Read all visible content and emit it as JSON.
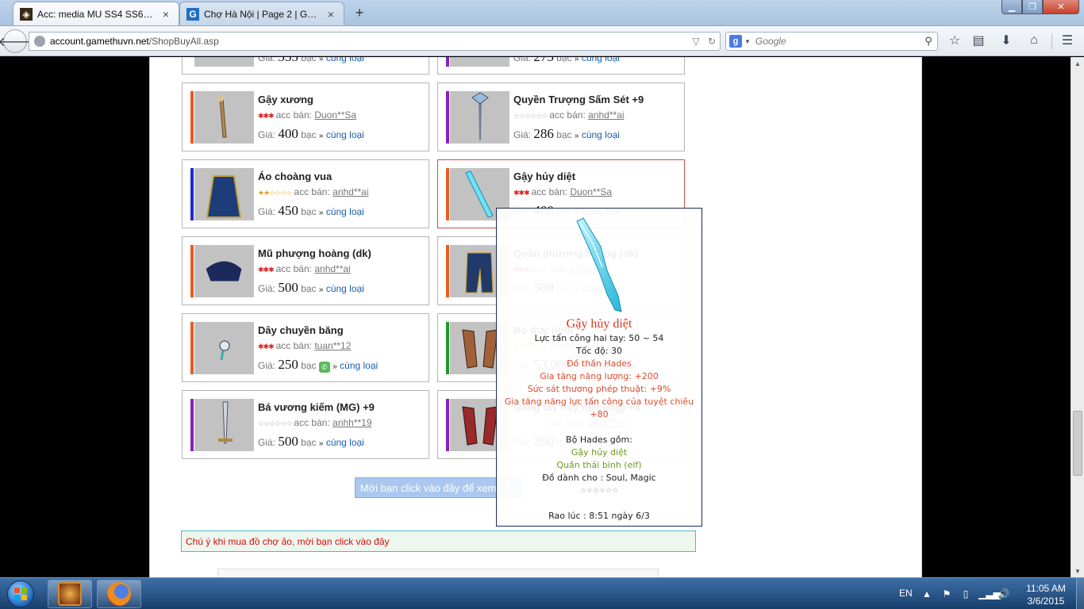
{
  "browser": {
    "tabs": [
      {
        "title": "Acc: media MU SS4 SS6 SS...",
        "active": true
      },
      {
        "title": "Chợ Hà Nội | Page 2 | Gam...",
        "active": false
      }
    ],
    "url_host": "account.gamethuvn.net",
    "url_path": "/ShopBuyAll.asp",
    "search_placeholder": "Google",
    "new_tab": "+",
    "close": "×"
  },
  "partial_row": {
    "left_price_prefix": "Giá:",
    "left_price": "555",
    "right_price_prefix": "Giá:",
    "right_price": "275",
    "unit": "bạc",
    "more": "cùng loại"
  },
  "items": [
    {
      "name": "Gậy xương",
      "stars": "✱✱✱",
      "star_color": "#e02020",
      "seller_label": "acc bán:",
      "seller": "Duon**Sa",
      "price_label": "Giá:",
      "price": "400",
      "unit": "bạc",
      "more": "cùng loại",
      "bar_color": "#e85a1e"
    },
    {
      "name": "Quyền Trượng Sấm Sét +9",
      "stars": "☆☆☆☆☆☆",
      "star_color": "#aaaaaa",
      "seller_label": "acc bán:",
      "seller": "anhd**ai",
      "price_label": "Giá:",
      "price": "286",
      "unit": "bạc",
      "more": "cùng loại",
      "bar_color": "#8a1fc0"
    },
    {
      "name": "Áo choàng vua",
      "stars": "★★☆☆☆☆",
      "star_color": "#e0a020",
      "seller_label": "acc bán:",
      "seller": "anhd**ai",
      "price_label": "Giá:",
      "price": "450",
      "unit": "bạc",
      "more": "cùng loại",
      "bar_color": "#1a2ad8"
    },
    {
      "name": "Gậy hủy diệt",
      "stars": "✱✱✱",
      "star_color": "#e02020",
      "seller_label": "acc bán:",
      "seller": "Duon**Sa",
      "price_label": "Giá:",
      "price": "400",
      "unit": "bạc",
      "more": "cùng loại",
      "bar_color": "#e85a1e"
    },
    {
      "name": "Mũ phượng hoàng (dk)",
      "stars": "✱✱✱",
      "star_color": "#e02020",
      "seller_label": "acc bán:",
      "seller": "anhd**ai",
      "price_label": "Giá:",
      "price": "500",
      "unit": "bạc",
      "more": "cùng loại",
      "bar_color": "#e85a1e"
    },
    {
      "name": "Quần phượng hoàng (dk)",
      "stars": "✱✱✱",
      "star_color": "#e02020",
      "seller_label": "acc bán:",
      "seller": "anhd",
      "price_label": "Giá:",
      "price": "500",
      "unit": "bạc",
      "more": "cùng loại",
      "bar_color": "#e85a1e"
    },
    {
      "name": "Dây chuyền băng",
      "stars": "✱✱✱",
      "star_color": "#e02020",
      "seller_label": "acc bán:",
      "seller": "tuan**12",
      "price_label": "Giá:",
      "price": "250",
      "unit": "bạc",
      "more": "cùng loại",
      "bar_color": "#e85a1e"
    },
    {
      "name": "Bộ thái bình",
      "stars": "★★★★☆☆",
      "star_color": "#e0a020",
      "seller_label": "acc bán:",
      "seller": "",
      "price_label": "Giá:",
      "price": "53,000",
      "unit": "bạc",
      "more": "cùng loại",
      "bar_color": "#1e9a2e"
    },
    {
      "name": "Bá vương kiếm (MG) +9",
      "stars": "☆☆☆☆☆☆",
      "star_color": "#aaaaaa",
      "seller_label": "acc bán:",
      "seller": "anhh**19",
      "price_label": "Giá:",
      "price": "500",
      "unit": "bạc",
      "more": "cùng loại",
      "bar_color": "#8a1fc0"
    },
    {
      "name": "Găng tay hủy diệt (mg) +4",
      "stars": "☆☆☆☆☆☆",
      "star_color": "#aaaaaa",
      "seller_label": "acc bán:",
      "seller": "tamk**en",
      "price_label": "Giá:",
      "price": "200",
      "unit": "bạc",
      "more": "cùng loại",
      "bar_color": "#8a1fc0"
    }
  ],
  "more_button": "Mời bạn click vào đây để xem tiếp",
  "notice": "Chú ý khi mua đồ chợ ảo, mời bạn click vào đây",
  "tooltip": {
    "title": "Gậy hủy diệt",
    "attack": "Lực tấn công hai tay: 50 ~ 54",
    "speed": "Tốc độ: 30",
    "set_item": "Đồ thần Hades",
    "opt1": "Gia tăng năng lượng: +200",
    "opt2": "Sức sát thương phép thuật: +9%",
    "opt3": "Gia tăng năng lực tấn công của tuyệt chiêu +80",
    "set_title": "Bộ Hades gồm:",
    "set1": "Gậy hủy diệt",
    "set2": "Quần thái bình (elf)",
    "for_class": "Đồ dành cho : Soul, Magic",
    "stars": "☆☆☆☆☆☆",
    "posted": "Rao lúc : 8:51 ngày 6/3"
  },
  "taskbar": {
    "lang": "EN",
    "time": "11:05 AM",
    "date": "3/6/2015"
  }
}
